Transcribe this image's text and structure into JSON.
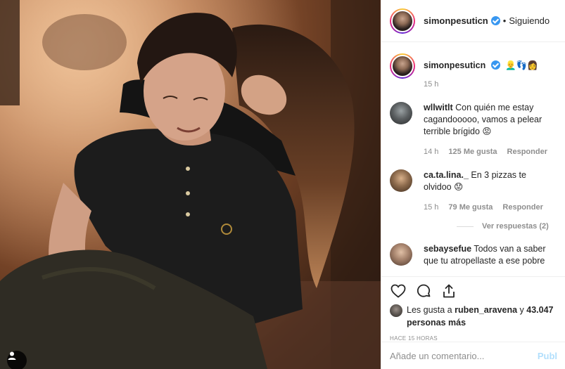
{
  "post": {
    "username": "simonpesuticn",
    "follow_state": "Siguiendo",
    "separator": "•",
    "caption_emojis": "👱‍♂️👣👩",
    "caption_time": "15 h"
  },
  "comments": [
    {
      "user": "wllwitlt",
      "text": "Con quién me estay cagandooooo, vamos a pelear terrible brígido 😡",
      "time": "14 h",
      "likes": "125 Me gusta",
      "reply": "Responder"
    },
    {
      "user": "ca.ta.lina._",
      "text": "En 3 pizzas te olvidoo 😟",
      "time": "15 h",
      "likes": "79 Me gusta",
      "reply": "Responder",
      "view_replies": "Ver respuestas (2)"
    },
    {
      "user": "sebaysefue",
      "text": "Todos van a saber que tu atropellaste a ese pobre"
    }
  ],
  "likes": {
    "prefix": "Les gusta a",
    "user": "ruben_aravena",
    "conjunction": "y",
    "count": "43.047 personas más"
  },
  "timestamp": "Hace 15 horas",
  "add_comment": {
    "placeholder": "Añade un comentario...",
    "publish": "Publ"
  },
  "icons": {
    "like": "heart-icon",
    "comment": "comment-icon",
    "share": "share-icon",
    "tags": "user-tag-icon",
    "verified": "verified-badge-icon"
  },
  "colors": {
    "verified": "#3897f0",
    "muted": "#8e8e8e",
    "text": "#262626",
    "border": "#efefef",
    "publish_disabled": "#b2dffc"
  }
}
